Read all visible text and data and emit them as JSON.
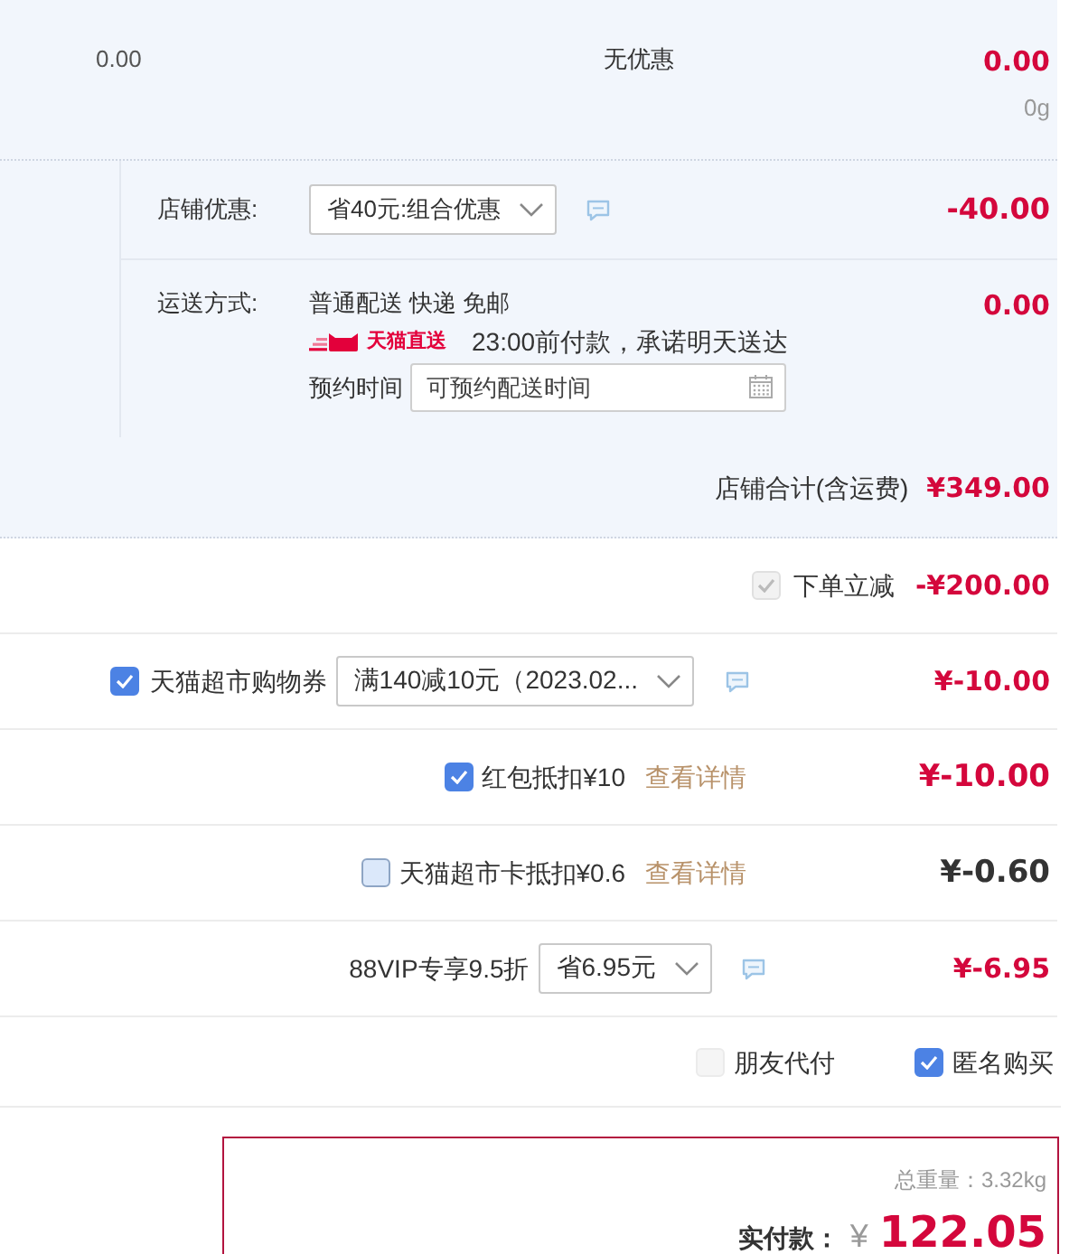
{
  "item_summary": {
    "unit_price": "0.00",
    "promotion": "无优惠",
    "amount": "0.00",
    "weight": "0g"
  },
  "store": {
    "discount": {
      "label": "店铺优惠:",
      "select_value": "省40元:组合优惠",
      "amount": "-40.00"
    },
    "shipping": {
      "label": "运送方式:",
      "method": "普通配送 快递 免邮",
      "badge": "天猫直送",
      "promise": "23:00前付款，承诺明天送达",
      "appointment_label": "预约时间",
      "appointment_placeholder": "可预约配送时间",
      "amount": "0.00"
    },
    "total_label": "店铺合计(含运费)",
    "total": "¥349.00"
  },
  "adjustments": [
    {
      "kind": "instant",
      "checked": true,
      "disabled": true,
      "label": "下单立减",
      "amount": "-¥200.00"
    },
    {
      "kind": "coupon",
      "checked": true,
      "disabled": false,
      "label": "天猫超市购物券",
      "select_value": "满140减10元（2023.02...",
      "amount": "¥-10.00"
    },
    {
      "kind": "credit",
      "checked": true,
      "disabled": false,
      "label": "红包抵扣¥10",
      "link": "查看详情",
      "amount": "¥-10.00"
    },
    {
      "kind": "credit",
      "checked": false,
      "disabled": false,
      "label": "天猫超市卡抵扣¥0.6",
      "link": "查看详情",
      "amount": "¥-0.60"
    },
    {
      "kind": "member",
      "label": "88VIP专享9.5折",
      "select_value": "省6.95元",
      "amount": "¥-6.95"
    }
  ],
  "options": [
    {
      "label": "朋友代付",
      "checked": false,
      "disabled": true
    },
    {
      "label": "匿名购买",
      "checked": true,
      "disabled": false
    }
  ],
  "payment": {
    "weight": "总重量：3.32kg",
    "label": "实付款：",
    "currency": "¥",
    "total": "122.05"
  }
}
